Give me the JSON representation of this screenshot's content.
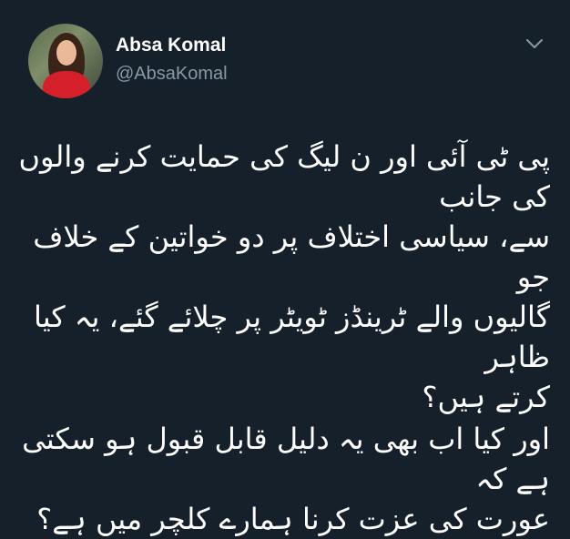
{
  "author": {
    "display_name": "Absa Komal",
    "handle": "@AbsaKomal",
    "avatar_icon": "profile-photo"
  },
  "menu": {
    "icon": "chevron-down-icon",
    "icon_color": "#8899a6"
  },
  "tweet": {
    "paragraph_1": "پی ٹی آئی اور ن لیگ کی حمایت کرنے والوں کی جانب\nسے، سیاسی اختلاف پر دو خواتین کے خلاف جو\nگالیوں والے ٹرینڈز ٹویٹر پر چلائے گئے، یہ کیا ظاہر\nکرتے ہیں؟",
    "paragraph_2": "اور کیا اب بھی یہ دلیل قابل قبول ہو سکتی ہے کہ\nعورت کی عزت کرنا ہمارے کلچر میں ہے؟"
  },
  "theme": {
    "background": "#15202b",
    "text_primary": "#ffffff",
    "text_secondary": "#8899a6",
    "avatar_accent": "#d51f2a"
  }
}
